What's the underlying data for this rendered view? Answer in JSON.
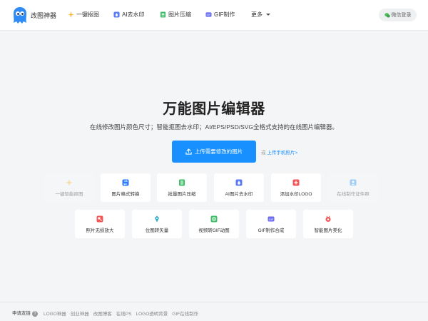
{
  "header": {
    "brand": "改图神器",
    "nav": [
      {
        "label": "一键抠图",
        "icon": "sparkle-icon"
      },
      {
        "label": "AI去水印",
        "icon": "ai-watermark-icon"
      },
      {
        "label": "图片压缩",
        "icon": "compress-icon"
      },
      {
        "label": "GIF制作",
        "icon": "gif-icon"
      },
      {
        "label": "更多",
        "icon": "chevron-down-icon"
      }
    ],
    "login_label": "微信登录"
  },
  "hero": {
    "title": "万能图片编辑器",
    "subtitle": "在线修改图片颜色尺寸；智能抠图去水印；AI/EPS/PSD/SVG全格式支持的在线图片编辑器。",
    "upload_label": "上传需要修改的图片",
    "or_text": "或",
    "phone_link": "上传手机照片>"
  },
  "tools_row1": [
    {
      "label": "一键智能抠图",
      "icon": "sparkle-icon",
      "color": "#f5b93a"
    },
    {
      "label": "图片格式转换",
      "icon": "convert-icon",
      "color": "#2f7cf6"
    },
    {
      "label": "批量图片压缩",
      "icon": "compress-icon",
      "color": "#3fbf6a"
    },
    {
      "label": "AI图片去水印",
      "icon": "ai-watermark-icon",
      "color": "#5b7cf6"
    },
    {
      "label": "添加水印LOGO",
      "icon": "add-logo-icon",
      "color": "#f25757"
    },
    {
      "label": "在线制作证件照",
      "icon": "id-photo-icon",
      "color": "#3aa2f5"
    }
  ],
  "tools_row2": [
    {
      "label": "照片无损放大",
      "icon": "enlarge-icon",
      "color": "#f25757"
    },
    {
      "label": "位图转矢量",
      "icon": "vector-icon",
      "color": "#2aa7c9"
    },
    {
      "label": "视频转GIF动图",
      "icon": "video-gif-icon",
      "color": "#3fbf6a"
    },
    {
      "label": "GIF制作合成",
      "icon": "gif-icon",
      "color": "#6b6ef0"
    },
    {
      "label": "智能图片美化",
      "icon": "beautify-icon",
      "color": "#f25757"
    }
  ],
  "footer": {
    "label": "申请友链",
    "links": [
      "LOGO神器",
      "创业神器",
      "改图博客",
      "在线PS",
      "LOGO透明背景",
      "GIF在线制作"
    ]
  }
}
